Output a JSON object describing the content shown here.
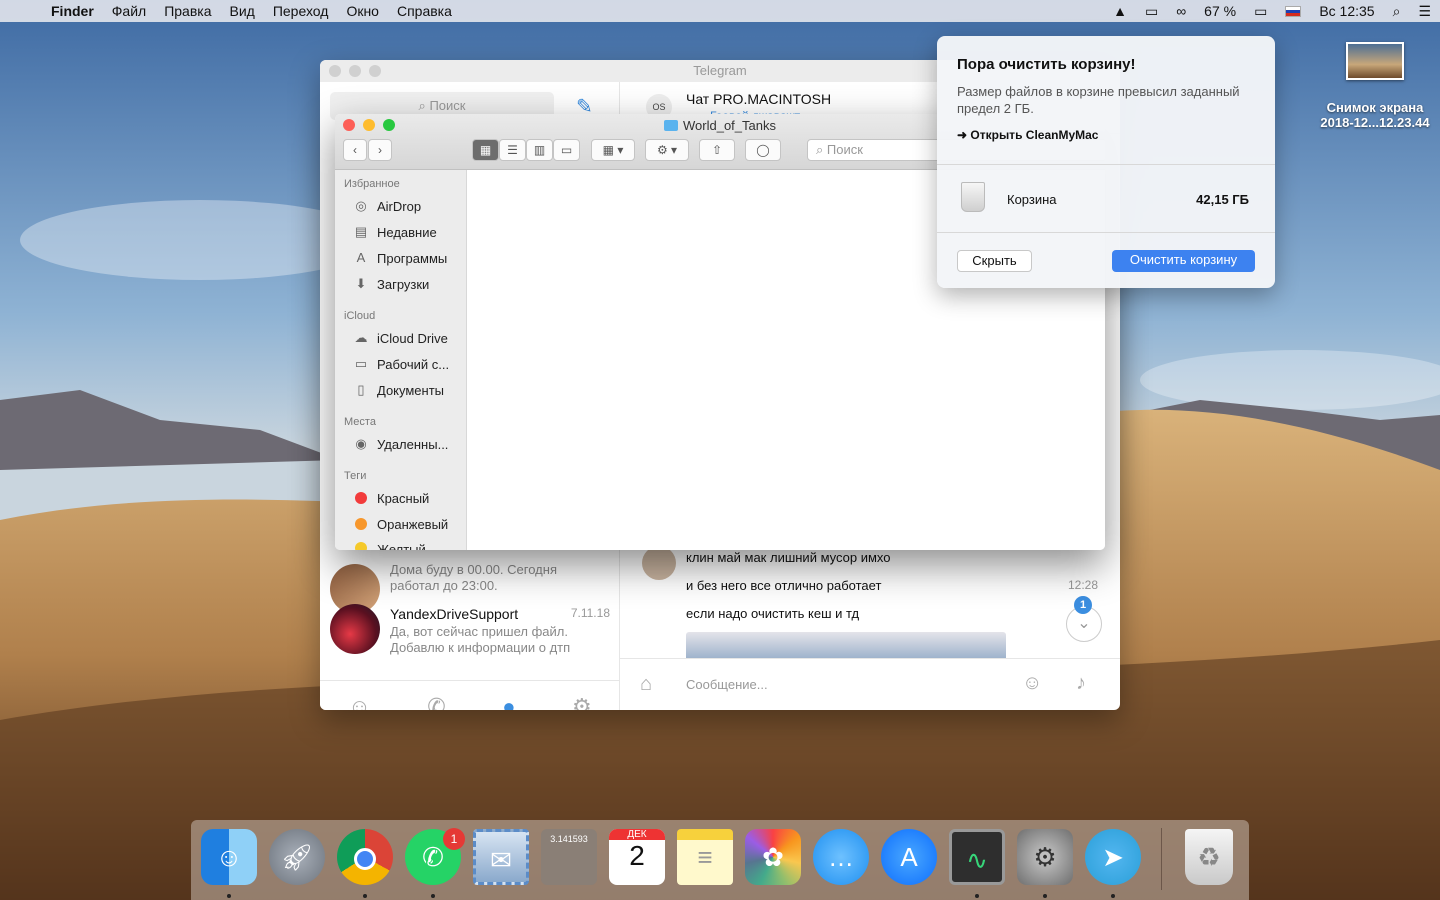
{
  "menubar": {
    "app": "Finder",
    "items": [
      "Файл",
      "Правка",
      "Вид",
      "Переход",
      "Окно",
      "Справка"
    ],
    "battery": "67 %",
    "clock": "Вс 12:35"
  },
  "desktop": {
    "file_name": "Снимок экрана",
    "file_date": "2018-12...12.23.44"
  },
  "telegram": {
    "window_title": "Telegram",
    "search_placeholder": "Поиск",
    "chat_name": "Чат PRO.MACINTOSH",
    "chat_avatar": "OS",
    "chat_status": "Гоовой джаважт",
    "chats": [
      {
        "name": "",
        "date": "",
        "preview": "Дома буду в 00.00. Сегодня работал до 23:00."
      },
      {
        "name": "YandexDriveSupport",
        "date": "7.11.18",
        "preview": "Да, вот сейчас пришел файл. Добавлю к информации о дтп"
      }
    ],
    "messages": [
      {
        "text": "клин май мак лишний мусор имхо"
      },
      {
        "text": "и без него все отлично работает"
      },
      {
        "text": "если надо очистить кеш и тд"
      }
    ],
    "message_time": "12:28",
    "scroll_badge": "1",
    "input_placeholder": "Сообщение..."
  },
  "finder": {
    "title": "World_of_Tanks",
    "search_placeholder": "Поиск",
    "sections": {
      "favorites": "Избранное",
      "icloud": "iCloud",
      "places": "Места",
      "tags": "Теги"
    },
    "favorites": [
      "AirDrop",
      "Недавние",
      "Программы",
      "Загрузки"
    ],
    "icloud_items": [
      "iCloud Drive",
      "Рабочий с...",
      "Документы"
    ],
    "places_items": [
      "Удаленны..."
    ],
    "tags_items": [
      {
        "label": "Красный",
        "color": "#f23b3b"
      },
      {
        "label": "Оранжевый",
        "color": "#f7972c"
      },
      {
        "label": "Желтый",
        "color": "#f5c92a"
      }
    ]
  },
  "notification": {
    "title": "Пора очистить корзину!",
    "text": "Размер файлов в корзине превысил заданный предел 2 ГБ.",
    "link": "Открыть CleanMyMac",
    "trash_label": "Корзина",
    "trash_size": "42,15 ГБ",
    "dismiss": "Скрыть",
    "action": "Очистить корзину",
    "accent": "#3d82f0"
  },
  "dock": {
    "whatsapp_badge": "1",
    "calendar_month": "ДЕК",
    "calendar_day": "2",
    "calculator_display": "3.141593"
  }
}
